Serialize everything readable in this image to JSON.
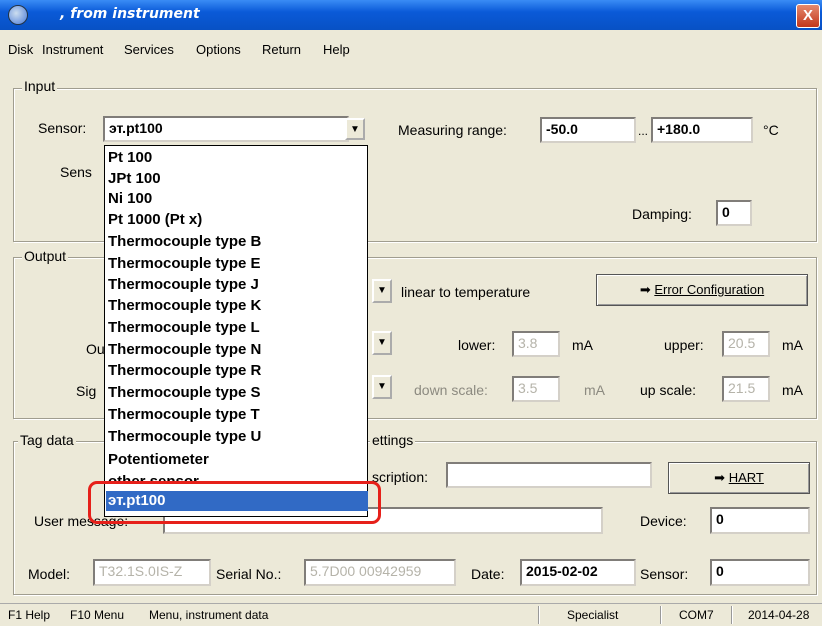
{
  "window": {
    "title": ", from instrument",
    "close_symbol": "X"
  },
  "menu": [
    "Disk",
    "Instrument",
    "Services",
    "Options",
    "Return",
    "Help"
  ],
  "input": {
    "group_label": "Input",
    "sensor_label": "Sensor:",
    "sensor_value": "эт.pt100",
    "sensor2_label_partial": "Sens",
    "measuring_range_label": "Measuring range:",
    "range_low": "-50.0",
    "range_sep": "...",
    "range_high": "+180.0",
    "range_unit": "°C",
    "damping_label": "Damping:",
    "damping_value": "0"
  },
  "dropdown": {
    "items": [
      "Pt 100",
      "JPt 100",
      "Ni 100",
      "Pt 1000 (Pt x)",
      "Thermocouple type B",
      "Thermocouple type E",
      "Thermocouple type J",
      "Thermocouple type K",
      "Thermocouple type L",
      "Thermocouple type N",
      "Thermocouple type R",
      "Thermocouple type S",
      "Thermocouple type T",
      "Thermocouple type U",
      "Potentiometer",
      "other sensor",
      "эт.pt100"
    ],
    "selected": "эт.pt100"
  },
  "output": {
    "group_label": "Output",
    "mode_text": "linear to temperature",
    "error_config_button": "Error Configuration",
    "ou_label_partial": "Ou",
    "sig_label_partial": "Sig",
    "lower_label": "lower:",
    "lower_value": "3.8",
    "upper_label": "upper:",
    "upper_value": "20.5",
    "down_scale_label": "down scale:",
    "down_scale_value": "3.5",
    "up_scale_label": "up scale:",
    "up_scale_value": "21.5",
    "unit": "mA"
  },
  "tag": {
    "group_label_partial": "Tag data",
    "settings_label_partial": "ettings",
    "description_label_partial": "scription:",
    "description_value": "",
    "hart_button": "HART",
    "user_message_label": "User message:",
    "user_message_value": "",
    "device_label": "Device:",
    "device_value": "0",
    "model_label": "Model:",
    "model_value": "T32.1S.0IS-Z",
    "serial_label": "Serial No.:",
    "serial_value": "5.7D00 00942959",
    "date_label": "Date:",
    "date_value": "2015-02-02",
    "sensor_label": "Sensor:",
    "sensor_value": "0"
  },
  "status": {
    "help": "F1 Help",
    "menu": "F10 Menu",
    "context": "Menu, instrument data",
    "role": "Specialist",
    "port": "COM7",
    "date": "2014-04-28"
  },
  "colors": {
    "selection": "#316ac5",
    "highlight_box": "#e6201a",
    "titlebar": "#0a5ad8"
  }
}
